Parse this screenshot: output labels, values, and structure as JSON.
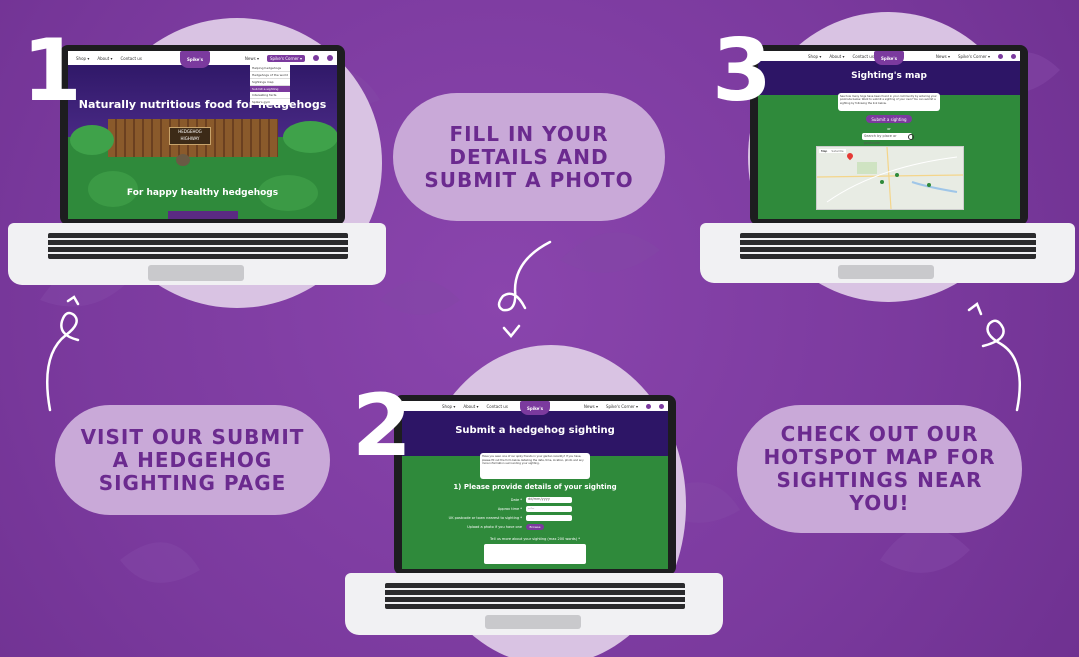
{
  "steps": [
    {
      "number": "1",
      "text_lines": [
        "VISIT OUR SUBMIT",
        "A HEDGEHOG",
        "SIGHTING PAGE"
      ]
    },
    {
      "number": "2",
      "text_lines": [
        "FILL IN YOUR",
        "DETAILS AND",
        "SUBMIT A PHOTO"
      ]
    },
    {
      "number": "3",
      "text_lines": [
        "CHECK OUT OUR",
        "HOTSPOT MAP FOR",
        "SIGHTINGS NEAR",
        "YOU!"
      ]
    }
  ],
  "screen1": {
    "nav": {
      "shop": "Shop ▾",
      "about": "About ▾",
      "contact": "Contact us",
      "news": "News ▾",
      "corner": "Spike's Corner ▾"
    },
    "logo": "Spike's",
    "dropdown": [
      "Helping hedgehogs",
      "Hedgehogs of the world",
      "Sightings map",
      "Submit a sighting",
      "Interesting facts",
      "Spike's gym"
    ],
    "headline": "Naturally nutritious food for hedgehogs",
    "sign": [
      "HEDGEHOG",
      "HIGHWAY"
    ],
    "tagline": "For happy healthy hedgehogs"
  },
  "screen2": {
    "nav": {
      "shop": "Shop ▾",
      "about": "About ▾",
      "contact": "Contact us",
      "news": "News ▾",
      "corner": "Spike's Corner ▾"
    },
    "logo": "Spike's",
    "title": "Submit a hedgehog sighting",
    "intro": "Have you seen one of our spiky friends in your garden recently? If you have, please fill out the form below detailing the date, time, location, photo and any more information surrounding your sighting.",
    "section": "1) Please provide details of your sighting",
    "fields": [
      {
        "label": "Date *",
        "value": "dd/mm/yyyy"
      },
      {
        "label": "Approx time *",
        "value": "--:--"
      },
      {
        "label": "UK postcode or town nearest to sighting *",
        "value": ""
      },
      {
        "label": "Upload a photo if you have one",
        "value": "Browse"
      }
    ],
    "textarea_label": "Tell us more about your sighting (max 200 words) *"
  },
  "screen3": {
    "nav": {
      "shop": "Shop ▾",
      "about": "About ▾",
      "contact": "Contact us",
      "news": "News ▾",
      "corner": "Spike's Corner ▾"
    },
    "logo": "Spike's",
    "title": "Sighting's map",
    "intro": "See how many hogs have been found in your community by entering your postcode below. Want to submit a sighting of your own? You can submit a sighting by following the link below.",
    "button": "Submit a sighting",
    "or": "or",
    "search_placeholder": "Search by place or postcode",
    "map_tabs": [
      "Map",
      "Satellite"
    ]
  },
  "colors": {
    "background": "#7a3a9c",
    "pill": "#c9a9d8",
    "pill_text": "#6b2a8f",
    "circle": "#d9c3e3",
    "accent": "#7b3a9e"
  },
  "icons": {
    "arrow": "curly-arrow-icon",
    "search": "search-icon",
    "map_pin": "map-pin-icon"
  }
}
